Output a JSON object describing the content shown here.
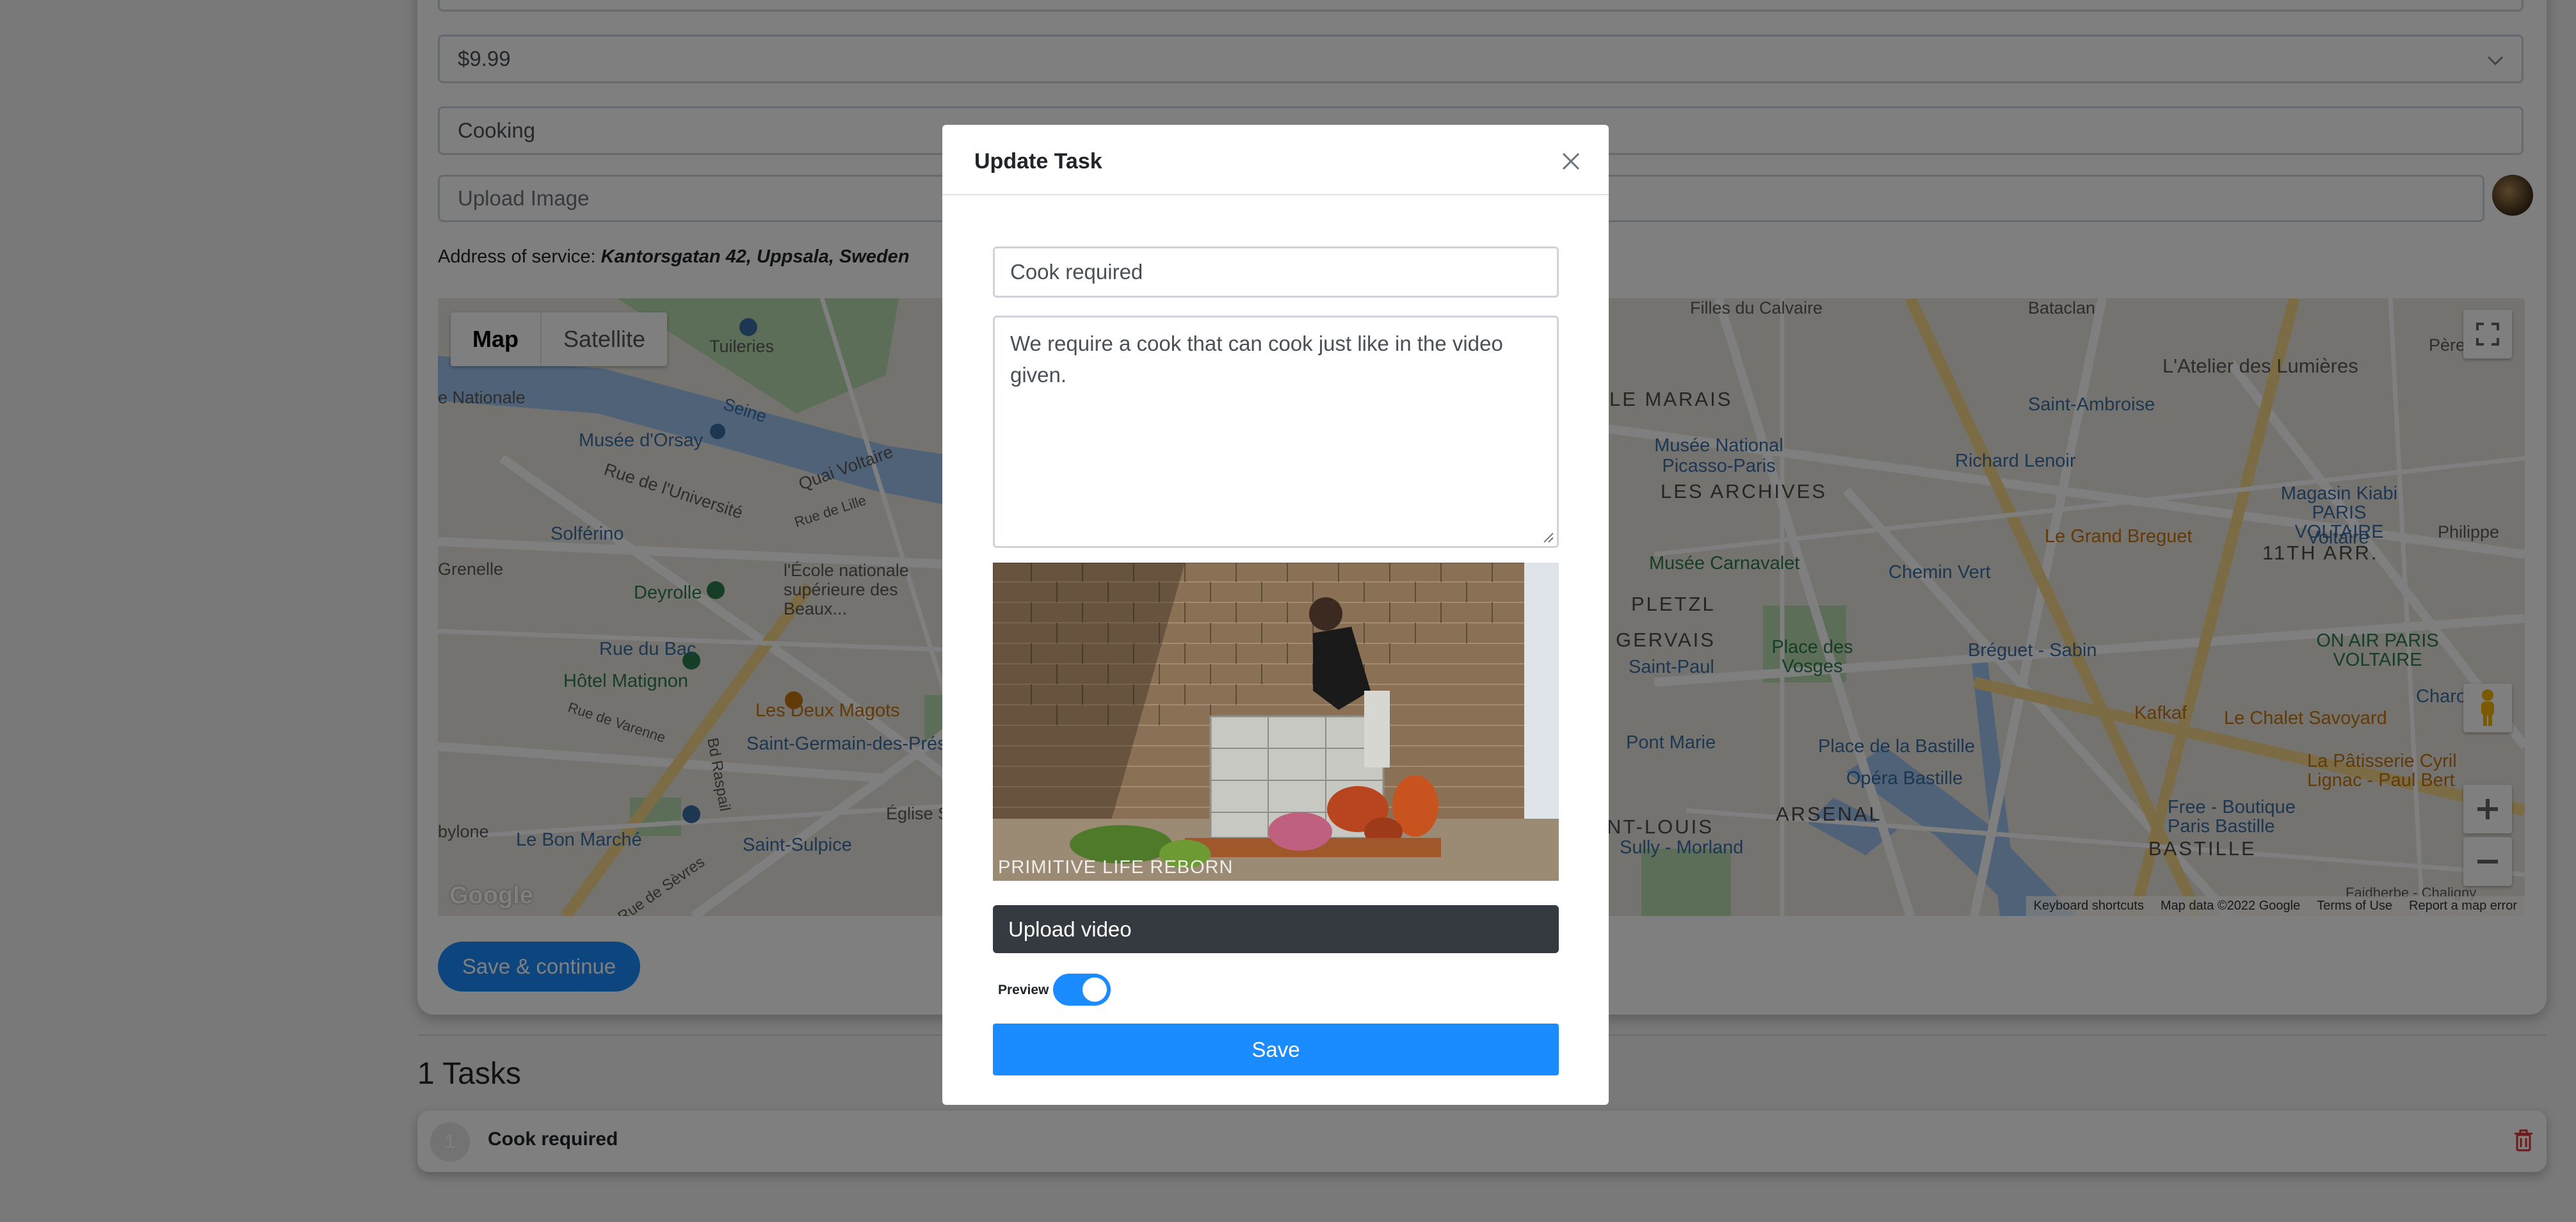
{
  "form": {
    "price_value": "$9.99",
    "category_value": "Cooking",
    "upload_image_placeholder": "Upload Image",
    "address_prefix": "Address of service:",
    "address_value": "Kantorsgatan 42, Uppsala, Sweden",
    "save_continue_label": "Save & continue"
  },
  "map": {
    "type_map": "Map",
    "type_satellite": "Satellite",
    "footer": {
      "shortcuts": "Keyboard shortcuts",
      "data": "Map data ©2022 Google",
      "terms": "Terms of Use",
      "report": "Report a map error"
    },
    "logo": "Google",
    "labels": {
      "tuileries": "Tuileries",
      "seine": "Seine",
      "musee_orsay": "Musée d'Orsay",
      "rue_universite": "Rue de l'Université",
      "quai_voltaire": "Quai Voltaire",
      "rue_lille": "Rue de Lille",
      "solferino": "Solférino",
      "deyrolle": "Deyrolle",
      "ecole": "l'École nationale supérieure des Beaux...",
      "grenelle": "Grenelle",
      "rue_bac": "Rue du Bac",
      "hotel_matignon": "Hôtel Matignon",
      "rue_varenne": "Rue de Varenne",
      "bd_raspail": "Bd Raspail",
      "deux_magots": "Les Deux Magots",
      "saint_germain": "Saint-Germain-des-Prés",
      "eglise_sulpice": "Église Saint-S...",
      "bon_marche": "Le Bon Marché",
      "saint_sulpice": "Saint-Sulpice",
      "rue_sevres": "Rue de Sèvres",
      "bylone": "bylone",
      "filles_calvaire": "Filles du Calvaire",
      "bataclan": "Bataclan",
      "atelier": "L'Atelier des Lumières",
      "pere": "Père",
      "marais": "LE MARAIS",
      "saint_ambroise": "Saint-Ambroise",
      "musee_picasso": "Musée National Picasso-Paris",
      "archives": "LES ARCHIVES",
      "richard_lenoir": "Richard Lenoir",
      "kiabi": "Magasin Kiabi PARIS VOLTAIRE",
      "voltaire": "Voltaire",
      "philippe": "Philippe",
      "grand_breguet": "Le Grand Breguet",
      "carnavalet": "Musée Carnavalet",
      "chemin_vert": "Chemin Vert",
      "arr11": "11TH ARR.",
      "pletzl": "PLETZL",
      "gervais": "GERVAIS",
      "saint_paul": "Saint-Paul",
      "place_vosges": "Place des Vosges",
      "breguet_sabin": "Bréguet - Sabin",
      "on_air": "ON AIR PARIS VOLTAIRE",
      "charonne": "Charonne",
      "kafkaf": "Kafkaf",
      "chalet": "Le Chalet Savoyard",
      "pont_marie": "Pont Marie",
      "place_bastille": "Place de la Bastille",
      "opera_bastille": "Opéra Bastille",
      "patisserie": "La Pâtisserie Cyril Lignac - Paul Bert",
      "free": "Free - Boutique Paris Bastille",
      "arsenal": "ARSENAL",
      "saint_louis": "NT-LOUIS",
      "sully": "Sully - Morland",
      "bastille": "BASTILLE",
      "nationale": "e Nationale",
      "faidherbe": "Faidherbe - Chaligny"
    }
  },
  "tasks": {
    "title": "1 Tasks",
    "items": [
      {
        "number": "1",
        "name": "Cook required"
      }
    ]
  },
  "modal": {
    "title": "Update Task",
    "title_value": "Cook required",
    "description_value": "We require a cook that can cook just like in the video given.",
    "video_watermark": "PRIMITIVE LIFE REBORN",
    "upload_video_label": "Upload video",
    "preview_label": "Preview",
    "preview_enabled": true,
    "save_label": "Save"
  },
  "colors": {
    "primary": "#1a8cff",
    "dark": "#343a40",
    "backdrop": "rgba(0,0,0,0.5)"
  }
}
